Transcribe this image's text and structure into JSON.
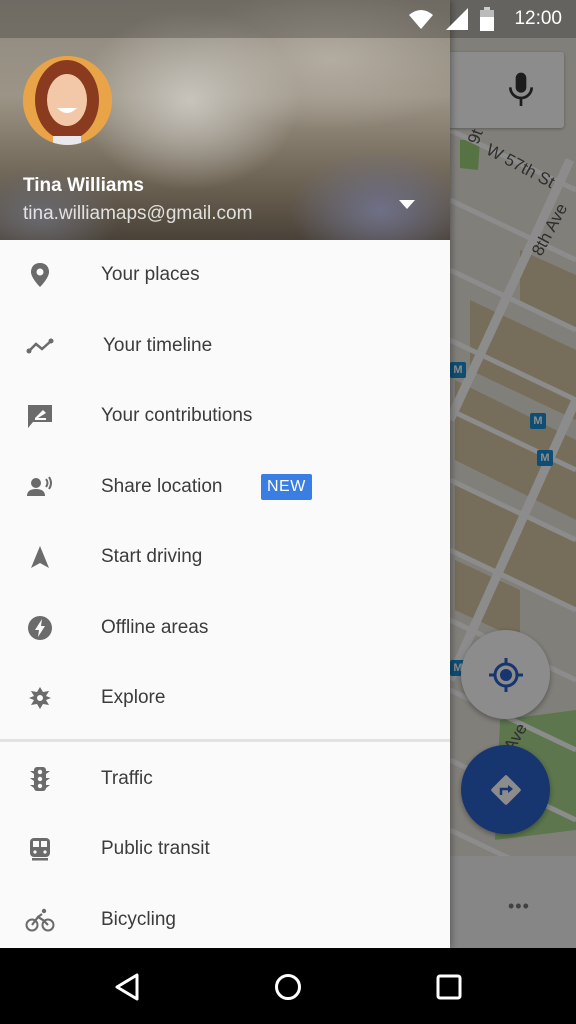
{
  "status_bar": {
    "time": "12:00",
    "icons": [
      "wifi-icon",
      "cell-signal-icon",
      "battery-icon"
    ]
  },
  "account": {
    "name": "Tina Williams",
    "email": "tina.williamaps@gmail.com"
  },
  "menu": {
    "primary": [
      {
        "label": "Your places",
        "icon": "place-pin-icon"
      },
      {
        "label": "Your timeline",
        "icon": "timeline-icon"
      },
      {
        "label": "Your contributions",
        "icon": "contributions-icon"
      },
      {
        "label": "Share location",
        "icon": "share-location-icon",
        "badge": "NEW"
      },
      {
        "label": "Start driving",
        "icon": "navigation-arrow-icon"
      },
      {
        "label": "Offline areas",
        "icon": "offline-bolt-icon"
      },
      {
        "label": "Explore",
        "icon": "explore-icon"
      }
    ],
    "layers": [
      {
        "label": "Traffic",
        "icon": "traffic-light-icon"
      },
      {
        "label": "Public transit",
        "icon": "train-icon"
      },
      {
        "label": "Bicycling",
        "icon": "bicycle-icon"
      }
    ]
  },
  "map": {
    "street_labels": [
      "W 57th St",
      "8th Ave",
      "9t",
      "Ave"
    ],
    "metro_label": "M",
    "more_label": "•••"
  },
  "colors": {
    "accent": "#3a7ee3",
    "fab_blue": "#2a62c9",
    "icon_gray": "#6b6b6b",
    "text_dark": "#3c3c3c"
  },
  "nav_bar": {
    "buttons": [
      "back",
      "home",
      "recents"
    ]
  }
}
